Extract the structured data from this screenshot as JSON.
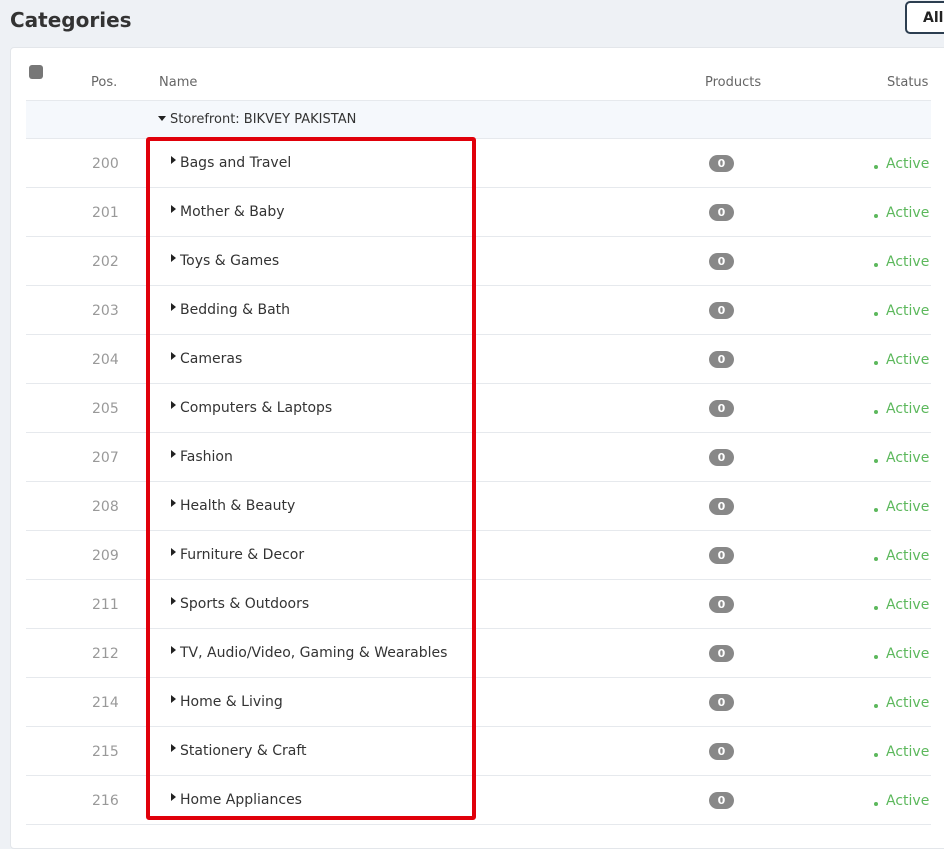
{
  "page": {
    "title": "Categories",
    "all_button_label": "All"
  },
  "table": {
    "columns": {
      "pos": "Pos.",
      "name": "Name",
      "products": "Products",
      "status": "Status"
    },
    "storefront_label": "Storefront: BIKVEY PAKISTAN",
    "rows": [
      {
        "pos": "200",
        "name": "Bags and Travel",
        "products": "0",
        "status": "Active"
      },
      {
        "pos": "201",
        "name": "Mother & Baby",
        "products": "0",
        "status": "Active"
      },
      {
        "pos": "202",
        "name": "Toys & Games",
        "products": "0",
        "status": "Active"
      },
      {
        "pos": "203",
        "name": "Bedding & Bath",
        "products": "0",
        "status": "Active"
      },
      {
        "pos": "204",
        "name": "Cameras",
        "products": "0",
        "status": "Active"
      },
      {
        "pos": "205",
        "name": "Computers & Laptops",
        "products": "0",
        "status": "Active"
      },
      {
        "pos": "207",
        "name": "Fashion",
        "products": "0",
        "status": "Active"
      },
      {
        "pos": "208",
        "name": "Health & Beauty",
        "products": "0",
        "status": "Active"
      },
      {
        "pos": "209",
        "name": "Furniture & Decor",
        "products": "0",
        "status": "Active"
      },
      {
        "pos": "211",
        "name": "Sports & Outdoors",
        "products": "0",
        "status": "Active"
      },
      {
        "pos": "212",
        "name": "TV, Audio/Video, Gaming & Wearables",
        "products": "0",
        "status": "Active"
      },
      {
        "pos": "214",
        "name": "Home & Living",
        "products": "0",
        "status": "Active"
      },
      {
        "pos": "215",
        "name": "Stationery & Craft",
        "products": "0",
        "status": "Active"
      },
      {
        "pos": "216",
        "name": "Home Appliances",
        "products": "0",
        "status": "Active"
      }
    ]
  },
  "colors": {
    "active": "#5cb85c",
    "highlight": "#e0000a",
    "badge": "#888888"
  }
}
